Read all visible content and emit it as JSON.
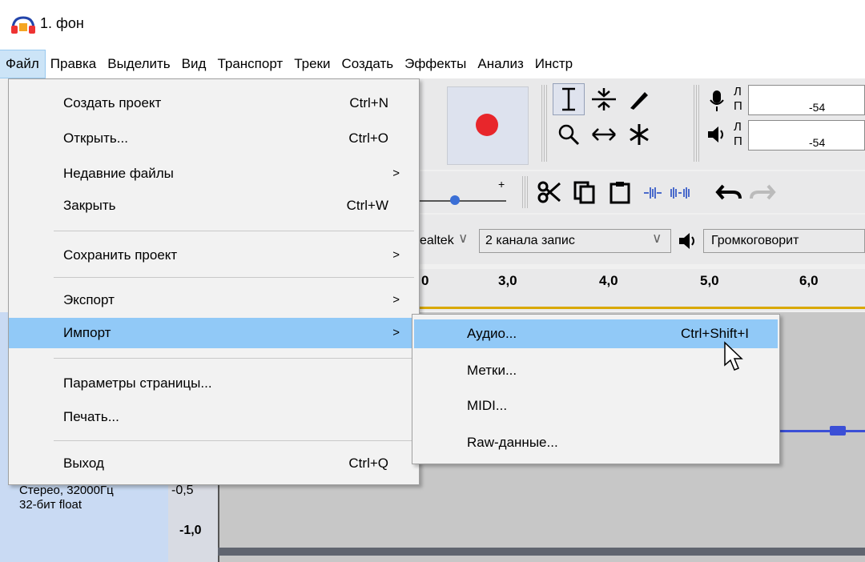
{
  "window": {
    "title": "1. фон",
    "app_icon": "headphones-icon"
  },
  "menubar": {
    "items": [
      "Файл",
      "Правка",
      "Выделить",
      "Вид",
      "Транспорт",
      "Треки",
      "Создать",
      "Эффекты",
      "Анализ",
      "Инстр"
    ]
  },
  "toolbar": {
    "meter_lr_top": [
      "Л",
      "П"
    ],
    "meter_lr_bottom": [
      "Л",
      "П"
    ],
    "meter_value_top": "-54",
    "meter_value_bottom": "-54",
    "slider_plus": "+",
    "device_host": "ealtek",
    "device_channels": "2 канала запис",
    "device_output": "Громкоговорит"
  },
  "timeline": {
    "ticks": [
      "0",
      "3,0",
      "4,0",
      "5,0",
      "6,0"
    ]
  },
  "track": {
    "info_line1": "Стерео, 32000Гц",
    "info_line2": "32-бит float",
    "scale_mid": "-0,5",
    "scale_bottom": "-1,0"
  },
  "file_menu": {
    "items": [
      {
        "label": "Создать проект",
        "shortcut": "Ctrl+N"
      },
      {
        "label": "Открыть...",
        "shortcut": "Ctrl+O"
      },
      {
        "label": "Недавние файлы",
        "submenu": ">"
      },
      {
        "label": "Закрыть",
        "shortcut": "Ctrl+W"
      },
      {
        "label": "Сохранить проект",
        "submenu": ">"
      },
      {
        "label": "Экспорт",
        "submenu": ">"
      },
      {
        "label": "Импорт",
        "submenu": ">"
      },
      {
        "label": "Параметры страницы..."
      },
      {
        "label": "Печать..."
      },
      {
        "label": "Выход",
        "shortcut": "Ctrl+Q"
      }
    ]
  },
  "import_menu": {
    "items": [
      {
        "label": "Аудио...",
        "shortcut": "Ctrl+Shift+I"
      },
      {
        "label": "Метки..."
      },
      {
        "label": "MIDI..."
      },
      {
        "label": "Raw-данные..."
      }
    ]
  },
  "colors": {
    "highlight": "#91c9f7",
    "menubar_active": "#cce4f7",
    "record": "#e8262b",
    "track_info": "#c9daf3"
  }
}
